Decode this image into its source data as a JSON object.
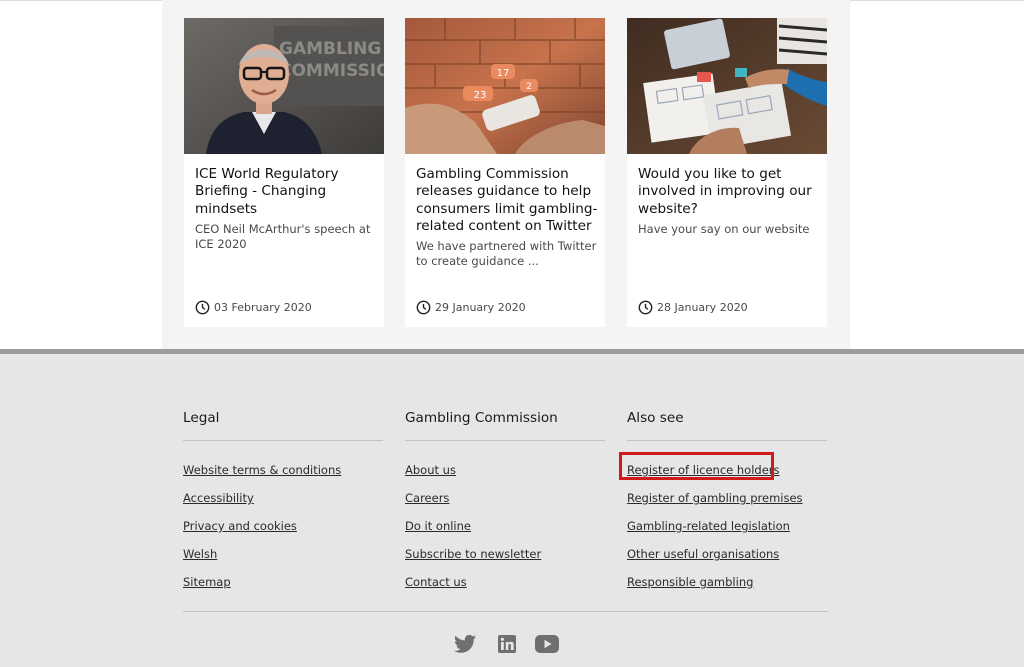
{
  "news": {
    "cards": [
      {
        "title": "ICE World Regulatory Briefing - Changing mindsets",
        "description": "CEO Neil McArthur's speech at ICE 2020",
        "date": "03 February 2020",
        "image_text": "GAMBLING COMMISSION"
      },
      {
        "title": "Gambling Commission releases guidance to help consumers limit gambling-related content on Twitter",
        "description": "We have partnered with Twitter to create guidance ...",
        "date": "29 January 2020",
        "image_badges": [
          "17",
          "23",
          "2"
        ]
      },
      {
        "title": "Would you like to get involved in improving our website?",
        "description": "Have your say on our website",
        "date": "28 January 2020"
      }
    ]
  },
  "footer": {
    "legal": {
      "title": "Legal",
      "links": [
        "Website terms & conditions",
        "Accessibility",
        "Privacy and cookies",
        "Welsh",
        "Sitemap"
      ]
    },
    "commission": {
      "title": "Gambling Commission",
      "links": [
        "About us",
        "Careers",
        "Do it online",
        "Subscribe to newsletter",
        "Contact us"
      ]
    },
    "also_see": {
      "title": "Also see",
      "links": [
        "Register of licence holders",
        "Register of gambling premises",
        "Gambling-related legislation",
        "Other useful organisations",
        "Responsible gambling"
      ]
    },
    "social_icons": [
      "twitter-icon",
      "linkedin-icon",
      "youtube-icon"
    ],
    "highlight_color": "#d2191c"
  }
}
